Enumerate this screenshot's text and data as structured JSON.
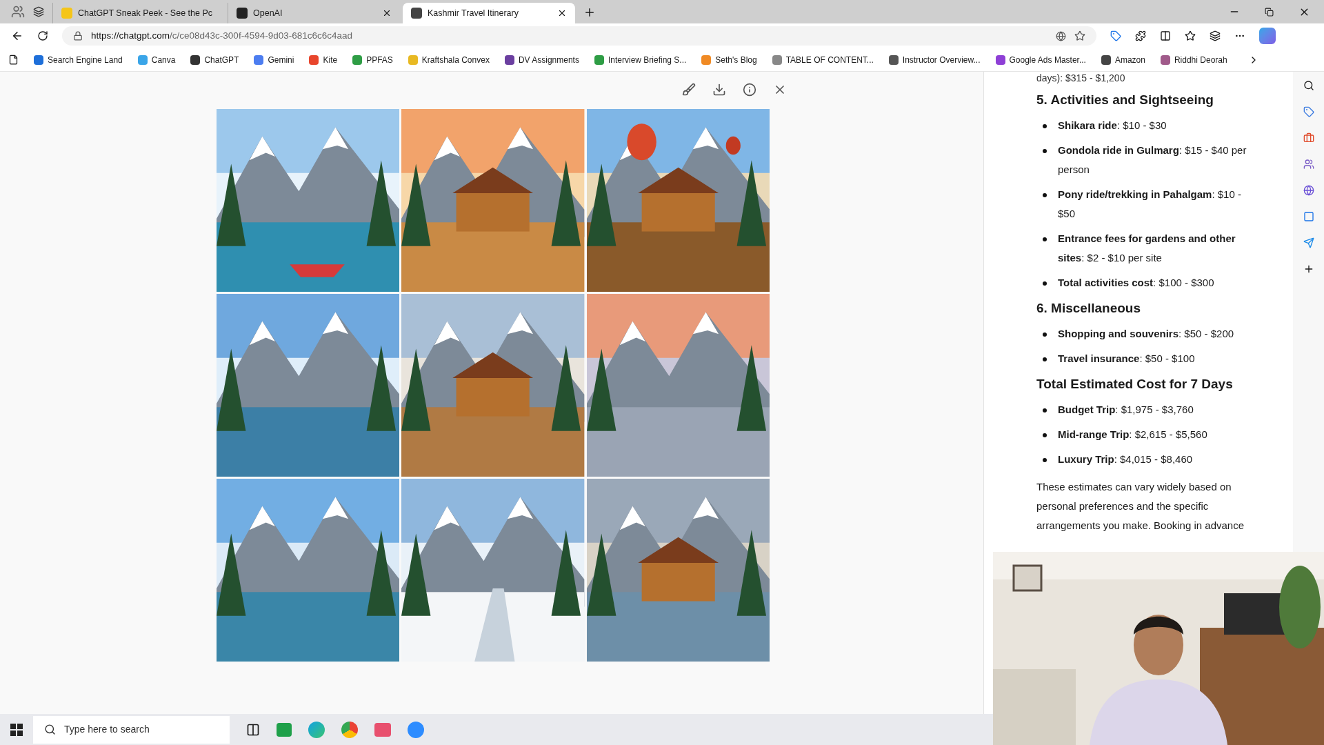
{
  "tabs": [
    {
      "title": "ChatGPT Sneak Peek - See the Pc",
      "selected": false,
      "color": "#f5c518"
    },
    {
      "title": "OpenAI",
      "selected": false,
      "color": "#222222"
    },
    {
      "title": "Kashmir Travel Itinerary",
      "selected": true,
      "color": "#444444"
    }
  ],
  "address": {
    "url_host": "https://chatgpt.com",
    "url_path": "/c/ce08d43c-300f-4594-9d03-681c6c6c4aad"
  },
  "bookmarks": [
    {
      "label": "Search Engine Land",
      "color": "#1e6fd9"
    },
    {
      "label": "Canva",
      "color": "#3aa5e8"
    },
    {
      "label": "ChatGPT",
      "color": "#333333"
    },
    {
      "label": "Gemini",
      "color": "#4c7df0"
    },
    {
      "label": "Kite",
      "color": "#e8452c"
    },
    {
      "label": "PPFAS",
      "color": "#2e9d45"
    },
    {
      "label": "Kraftshala Convex",
      "color": "#e8b923"
    },
    {
      "label": "DV Assignments",
      "color": "#6b3fa0"
    },
    {
      "label": "Interview Briefing S...",
      "color": "#2e9d45"
    },
    {
      "label": "Seth's Blog",
      "color": "#f08a24"
    },
    {
      "label": "TABLE OF CONTENT...",
      "color": "#888888"
    },
    {
      "label": "Instructor Overview...",
      "color": "#555555"
    },
    {
      "label": "Google Ads Master...",
      "color": "#8e3fd6"
    },
    {
      "label": "Amazon",
      "color": "#444444"
    },
    {
      "label": "Riddhi Deorah",
      "color": "#a05a8a"
    }
  ],
  "chat": {
    "cut_line": "days): $315 - $1,200",
    "sections": [
      {
        "heading": "5. Activities and Sightseeing",
        "items": [
          "**Shikara ride**: $10 - $30",
          "**Gondola ride in Gulmarg**: $15 - $40 per person",
          "**Pony ride/trekking in Pahalgam**: $10 - $50",
          "**Entrance fees for gardens and other sites**: $2 - $10 per site",
          "**Total activities cost**: $100 - $300"
        ]
      },
      {
        "heading": "6. Miscellaneous",
        "items": [
          "**Shopping and souvenirs**: $50 - $200",
          "**Travel insurance**: $50 - $100"
        ]
      },
      {
        "heading": "Total Estimated Cost for 7 Days",
        "items": [
          "**Budget Trip**: $1,975 - $3,760",
          "**Mid-range Trip**: $2,615 - $5,560",
          "**Luxury Trip**: $4,015 - $8,460"
        ]
      }
    ],
    "paragraph": "These estimates can vary widely based on personal preferences and the specific arrangements you make. Booking in advance"
  },
  "taskbar": {
    "search_placeholder": "Type here to search"
  }
}
